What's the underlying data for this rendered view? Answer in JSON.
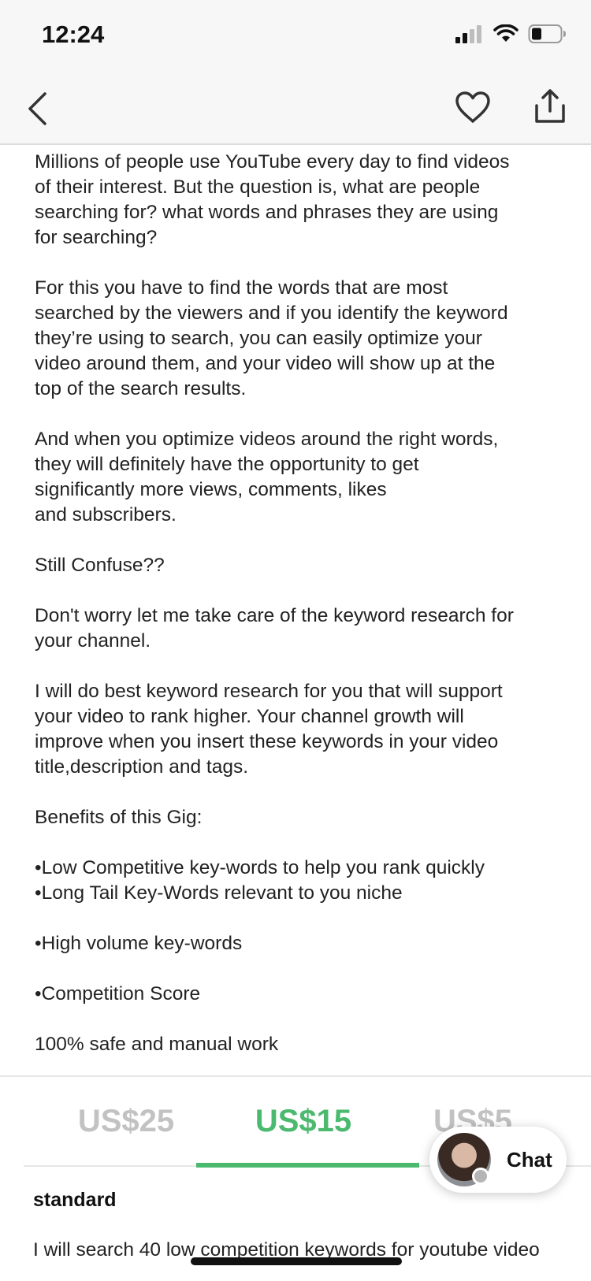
{
  "status_bar": {
    "time": "12:24"
  },
  "nav": {
    "back_icon": "chevron-left-icon",
    "favorite_icon": "heart-outline-icon",
    "share_icon": "share-upload-icon"
  },
  "description": {
    "paragraphs": [
      "Millions of people use YouTube every day to find videos\nof their interest. But the question is, what are people\nsearching for? what words and phrases they are using\nfor searching?",
      "For this you have to find the words that are most\nsearched by the viewers and if you identify the keyword\nthey’re using to search, you can easily optimize your\nvideo around them, and your video will show up at the\ntop of the search results.",
      "And when you optimize videos around the right words,\nthey will definitely have the opportunity to get\nsignificantly more views, comments, likes\nand subscribers.",
      "Still Confuse??",
      "Don't worry let me take care of the keyword research for\nyour channel.",
      "I will do best keyword research for you that will support\nyour video to rank higher. Your channel growth will\nimprove when you insert these keywords in your video\ntitle,description and tags.",
      "Benefits of this Gig:",
      "•Low Competitive key-words to help you rank quickly\n•Long Tail Key-Words relevant to you niche",
      "•High volume key-words",
      "•Competition Score",
      "100% safe and manual work"
    ]
  },
  "pricing": {
    "tabs": [
      {
        "label": "US$25"
      },
      {
        "label": "US$15"
      },
      {
        "label": "US$5"
      }
    ],
    "selected_index": 1,
    "package_name": "standard",
    "package_description": "I will search 40 low competition keywords for youtube video"
  },
  "chat": {
    "label": "Chat",
    "status": "offline"
  },
  "colors": {
    "accent": "#4bb96e",
    "inactive_tab": "#c2c2c2",
    "bar_background": "#f7f7f7"
  }
}
